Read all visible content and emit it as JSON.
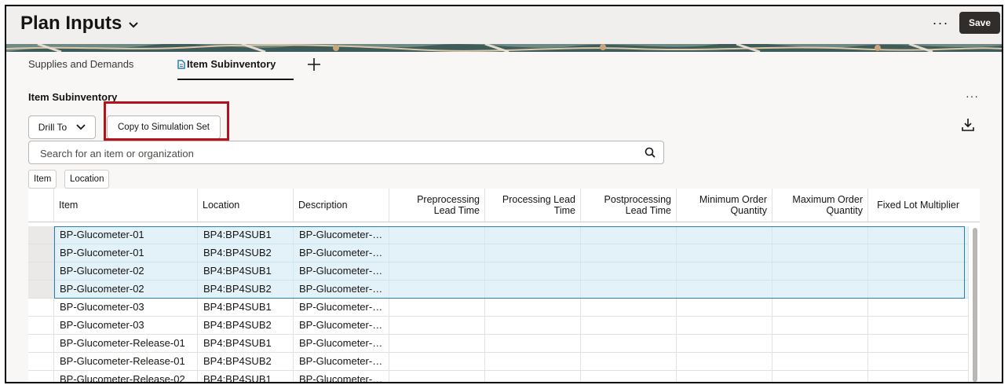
{
  "header": {
    "title": "Plan Inputs",
    "more_label": "···",
    "save_label": "Save"
  },
  "tabs": [
    {
      "label": "Supplies and Demands",
      "active": false
    },
    {
      "label": "Item Subinventory",
      "active": true
    }
  ],
  "section": {
    "title": "Item Subinventory",
    "more_label": "···",
    "drill_to_label": "Drill To",
    "copy_label": "Copy to Simulation Set"
  },
  "search": {
    "placeholder": "Search for an item or organization",
    "value": ""
  },
  "filter_chips": [
    "Item",
    "Location"
  ],
  "table": {
    "columns": [
      {
        "label": "Item",
        "align": "left"
      },
      {
        "label": "Location",
        "align": "left"
      },
      {
        "label": "Description",
        "align": "left"
      },
      {
        "label": "Preprocessing Lead Time",
        "align": "right"
      },
      {
        "label": "Processing Lead Time",
        "align": "right"
      },
      {
        "label": "Postprocessing Lead Time",
        "align": "right"
      },
      {
        "label": "Minimum Order Quantity",
        "align": "right"
      },
      {
        "label": "Maximum Order Quantity",
        "align": "right"
      },
      {
        "label": "Fixed Lot Multiplier",
        "align": "right"
      }
    ],
    "rows": [
      {
        "item": "BP-Glucometer-01",
        "location": "BP4:BP4SUB1",
        "description": "BP-Glucometer-…",
        "selected": true
      },
      {
        "item": "BP-Glucometer-01",
        "location": "BP4:BP4SUB2",
        "description": "BP-Glucometer-…",
        "selected": true
      },
      {
        "item": "BP-Glucometer-02",
        "location": "BP4:BP4SUB1",
        "description": "BP-Glucometer-…",
        "selected": true
      },
      {
        "item": "BP-Glucometer-02",
        "location": "BP4:BP4SUB2",
        "description": "BP-Glucometer-…",
        "selected": true
      },
      {
        "item": "BP-Glucometer-03",
        "location": "BP4:BP4SUB1",
        "description": "BP-Glucometer-…",
        "selected": false
      },
      {
        "item": "BP-Glucometer-03",
        "location": "BP4:BP4SUB2",
        "description": "BP-Glucometer-…",
        "selected": false
      },
      {
        "item": "BP-Glucometer-Release-01",
        "location": "BP4:BP4SUB1",
        "description": "BP-Glucometer-…",
        "selected": false
      },
      {
        "item": "BP-Glucometer-Release-01",
        "location": "BP4:BP4SUB2",
        "description": "BP-Glucometer-…",
        "selected": false
      },
      {
        "item": "BP-Glucometer-Release-02",
        "location": "BP4:BP4SUB1",
        "description": "BP-Glucometer-…",
        "selected": false
      }
    ]
  },
  "colors": {
    "accent": "#2a7db0",
    "highlight": "#b3141c",
    "save_bg": "#312d2a",
    "selected_row": "#e3f1f8"
  }
}
